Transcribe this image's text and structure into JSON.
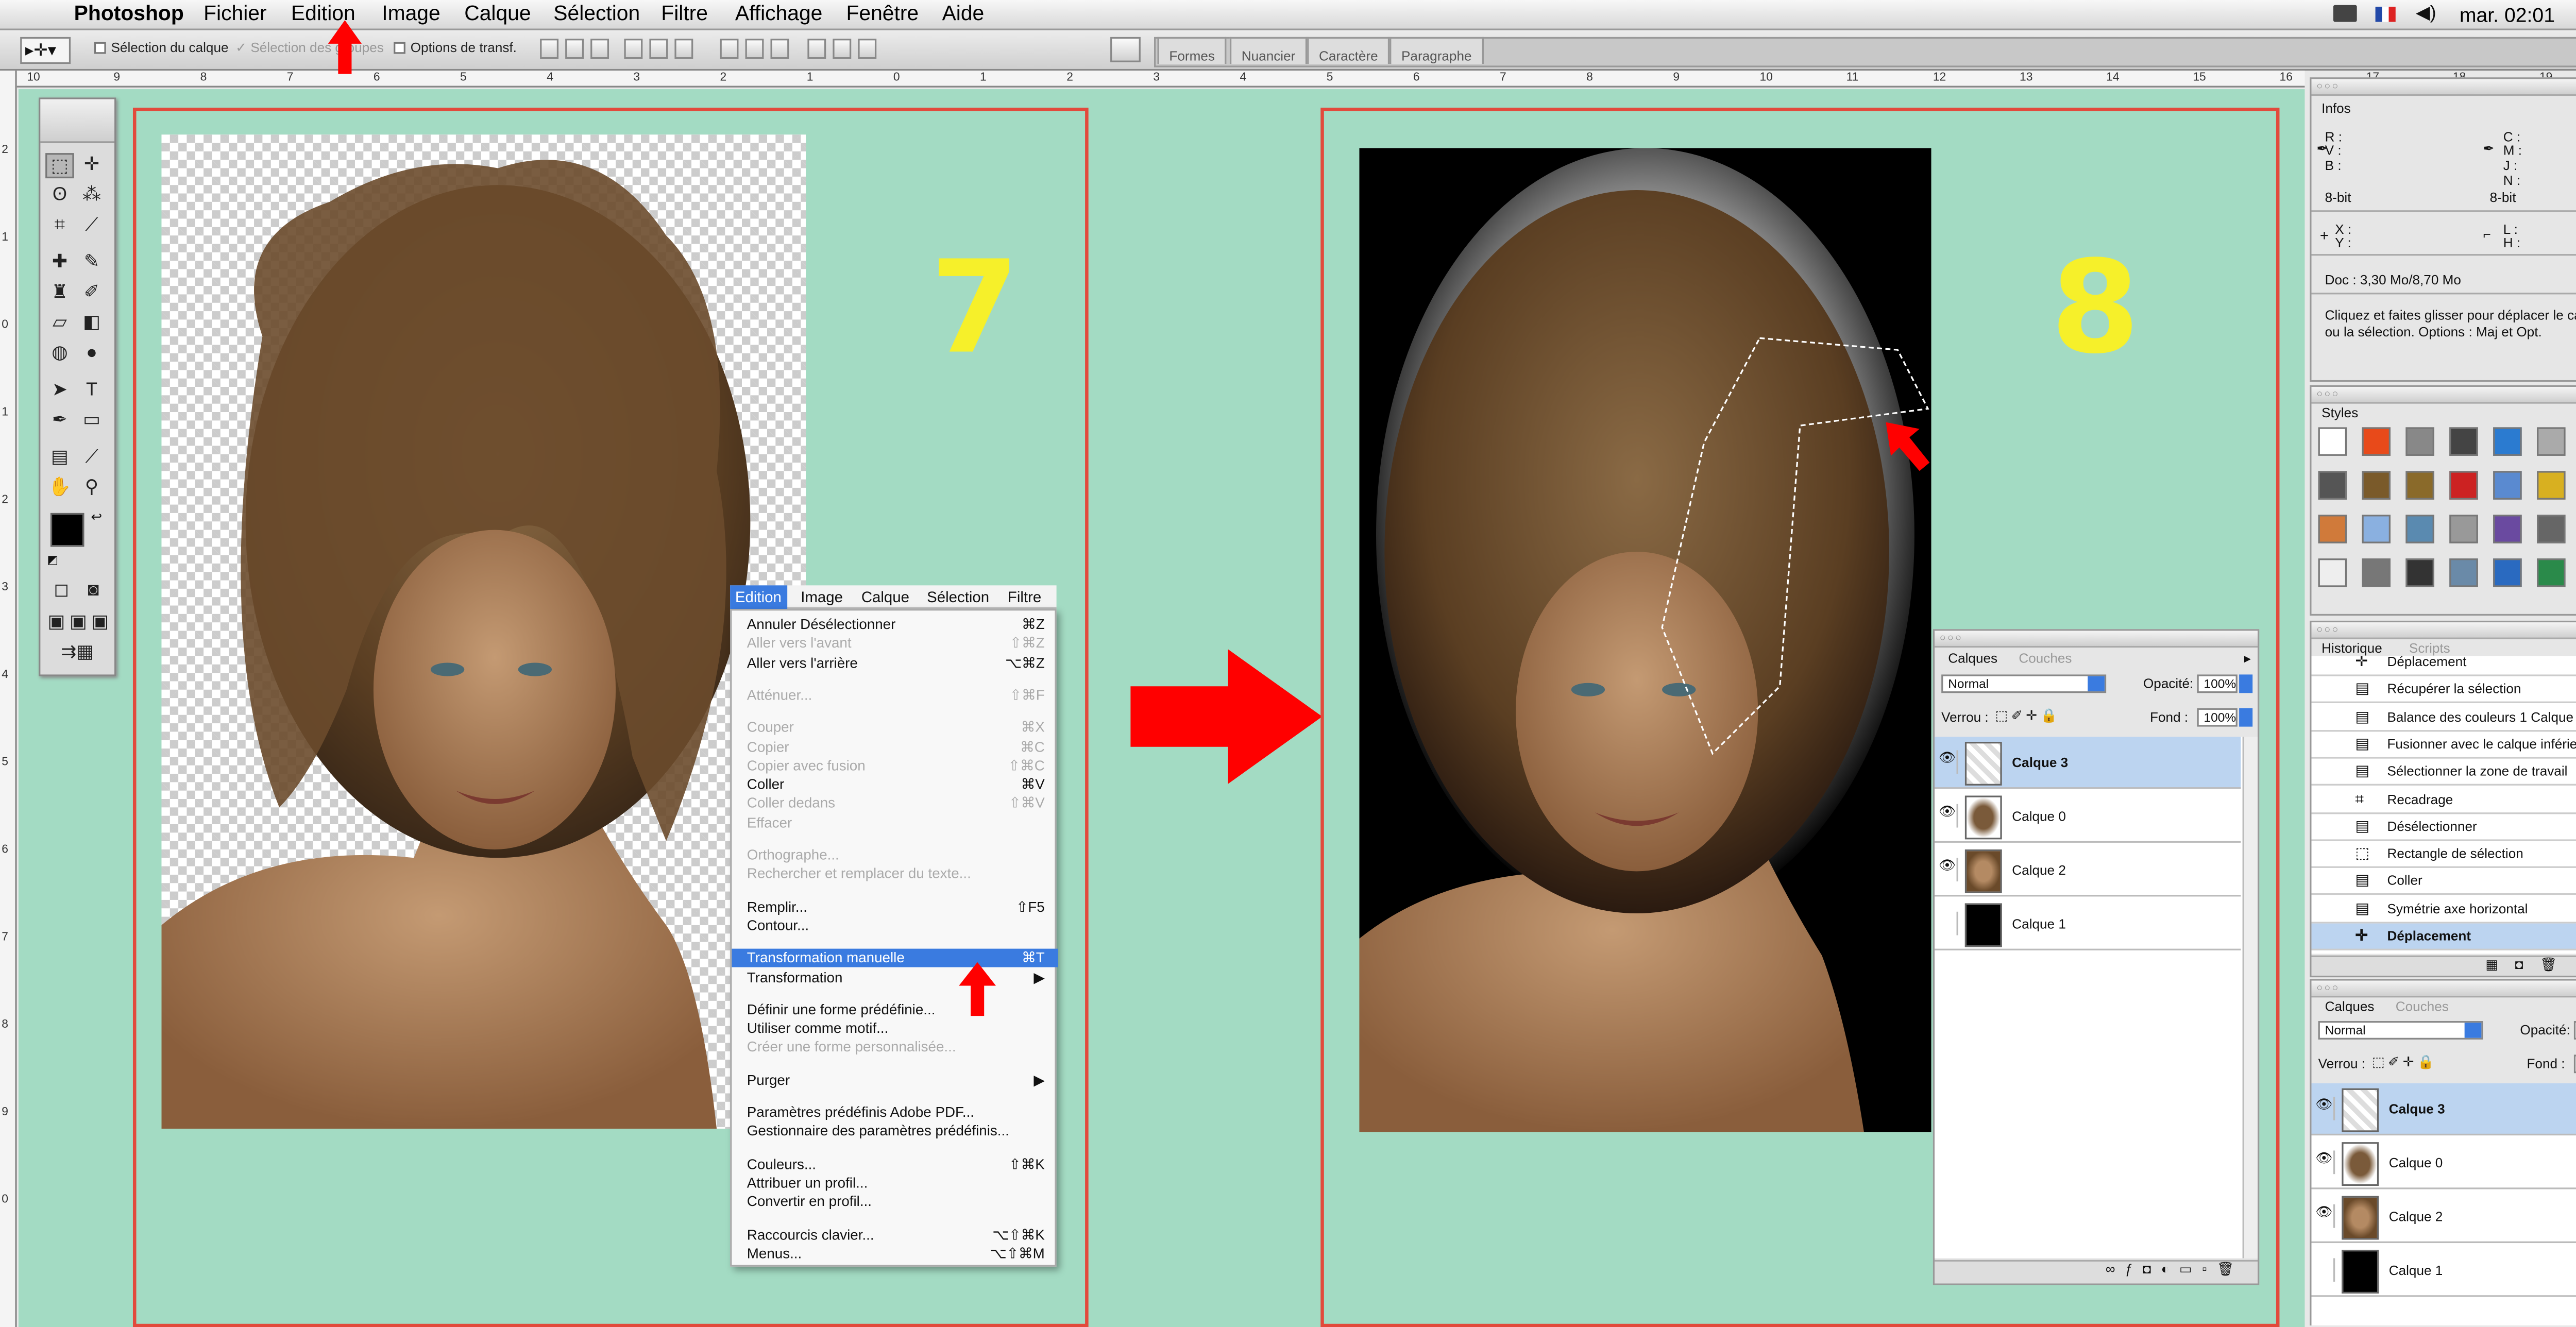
{
  "menubar": {
    "app": "Photoshop",
    "items": [
      "Fichier",
      "Edition",
      "Image",
      "Calque",
      "Sélection",
      "Filtre",
      "Affichage",
      "Fenêtre",
      "Aide"
    ],
    "clock": "mar. 02:01"
  },
  "options_bar": {
    "auto_select_layer": "Sélection du calque",
    "auto_select_groups": "Sélection des groupes",
    "show_transform": "Options de transf.",
    "palette_tabs": [
      "Formes",
      "Nuancier",
      "Caractère",
      "Paragraphe"
    ]
  },
  "rulers": {
    "horizontal_ticks": [
      "10",
      "9",
      "8",
      "7",
      "6",
      "5",
      "4",
      "3",
      "2",
      "1",
      "0",
      "1",
      "2",
      "3",
      "4",
      "5",
      "6",
      "7",
      "8",
      "9",
      "10",
      "11",
      "12",
      "13",
      "14",
      "15",
      "16",
      "17",
      "18",
      "19"
    ],
    "vertical_ticks": [
      "2",
      "1",
      "0",
      "1",
      "2",
      "3",
      "4",
      "5",
      "6",
      "7",
      "8",
      "9",
      "0"
    ]
  },
  "canvas": {
    "step_left": "7",
    "step_right": "8"
  },
  "context_menu": {
    "menubar": [
      "Edition",
      "Image",
      "Calque",
      "Sélection",
      "Filtre"
    ],
    "items": [
      {
        "label": "Annuler Désélectionner",
        "shortcut": "⌘Z",
        "disabled": false
      },
      {
        "label": "Aller vers l'avant",
        "shortcut": "⇧⌘Z",
        "disabled": true
      },
      {
        "label": "Aller vers l'arrière",
        "shortcut": "⌥⌘Z",
        "disabled": false
      },
      {
        "label": "Atténuer...",
        "shortcut": "⇧⌘F",
        "disabled": true
      },
      {
        "label": "Couper",
        "shortcut": "⌘X",
        "disabled": true
      },
      {
        "label": "Copier",
        "shortcut": "⌘C",
        "disabled": true
      },
      {
        "label": "Copier avec fusion",
        "shortcut": "⇧⌘C",
        "disabled": true
      },
      {
        "label": "Coller",
        "shortcut": "⌘V",
        "disabled": false
      },
      {
        "label": "Coller dedans",
        "shortcut": "⇧⌘V",
        "disabled": true
      },
      {
        "label": "Effacer",
        "shortcut": "",
        "disabled": true
      },
      {
        "label": "Orthographe...",
        "shortcut": "",
        "disabled": true
      },
      {
        "label": "Rechercher et remplacer du texte...",
        "shortcut": "",
        "disabled": true
      },
      {
        "label": "Remplir...",
        "shortcut": "⇧F5",
        "disabled": false
      },
      {
        "label": "Contour...",
        "shortcut": "",
        "disabled": false
      },
      {
        "label": "Transformation manuelle",
        "shortcut": "⌘T",
        "disabled": false,
        "highlighted": true
      },
      {
        "label": "Transformation",
        "shortcut": "▶",
        "disabled": false
      },
      {
        "label": "Définir une forme prédéfinie...",
        "shortcut": "",
        "disabled": false
      },
      {
        "label": "Utiliser comme motif...",
        "shortcut": "",
        "disabled": false
      },
      {
        "label": "Créer une forme personnalisée...",
        "shortcut": "",
        "disabled": true
      },
      {
        "label": "Purger",
        "shortcut": "▶",
        "disabled": false
      },
      {
        "label": "Paramètres prédéfinis Adobe PDF...",
        "shortcut": "",
        "disabled": false
      },
      {
        "label": "Gestionnaire des paramètres prédéfinis...",
        "shortcut": "",
        "disabled": false
      },
      {
        "label": "Couleurs...",
        "shortcut": "⇧⌘K",
        "disabled": false
      },
      {
        "label": "Attribuer un profil...",
        "shortcut": "",
        "disabled": false
      },
      {
        "label": "Convertir en profil...",
        "shortcut": "",
        "disabled": false
      },
      {
        "label": "Raccourcis clavier...",
        "shortcut": "⌥⇧⌘K",
        "disabled": false
      },
      {
        "label": "Menus...",
        "shortcut": "⌥⇧⌘M",
        "disabled": false
      }
    ]
  },
  "layers_panel": {
    "tabs": [
      "Calques",
      "Couches"
    ],
    "blend_mode": "Normal",
    "opacity_label": "Opacité:",
    "opacity": "100%",
    "lock_label": "Verrou :",
    "fill_label": "Fond :",
    "fill": "100%",
    "layers": [
      {
        "name": "Calque 3",
        "visible": true,
        "selected": true
      },
      {
        "name": "Calque 0",
        "visible": true,
        "selected": false
      },
      {
        "name": "Calque 2",
        "visible": true,
        "selected": false
      },
      {
        "name": "Calque 1",
        "visible": false,
        "selected": false
      }
    ]
  },
  "info_panel": {
    "title": "Infos",
    "r": "R :",
    "v": "V :",
    "b": "B :",
    "c": "C :",
    "m": "M :",
    "j": "J :",
    "n": "N :",
    "bit_left": "8-bit",
    "bit_right": "8-bit",
    "x": "X :",
    "y": "Y :",
    "l": "L :",
    "h": "H :",
    "doc": "Doc : 3,30 Mo/8,70 Mo",
    "hint": "Cliquez et faites glisser pour déplacer le calque ou la sélection. Options : Maj et Opt."
  },
  "styles_panel": {
    "title": "Styles"
  },
  "history_panel": {
    "tabs": [
      "Historique",
      "Scripts"
    ],
    "items": [
      {
        "label": "Déplacement",
        "selected": false
      },
      {
        "label": "Récupérer la sélection",
        "selected": false
      },
      {
        "label": "Balance des couleurs 1 Calque",
        "selected": false
      },
      {
        "label": "Fusionner avec le calque inférieur",
        "selected": false
      },
      {
        "label": "Sélectionner la zone de travail",
        "selected": false
      },
      {
        "label": "Recadrage",
        "selected": false
      },
      {
        "label": "Désélectionner",
        "selected": false
      },
      {
        "label": "Rectangle de sélection",
        "selected": false
      },
      {
        "label": "Coller",
        "selected": false
      },
      {
        "label": "Symétrie axe horizontal",
        "selected": false
      },
      {
        "label": "Déplacement",
        "selected": true
      }
    ]
  },
  "colors": {
    "canvas_bg": "#a3dbc3",
    "frame": "#e24a3c",
    "step_number": "#f6f02a",
    "highlight": "#3a7be0",
    "arrow": "#ff0000"
  }
}
